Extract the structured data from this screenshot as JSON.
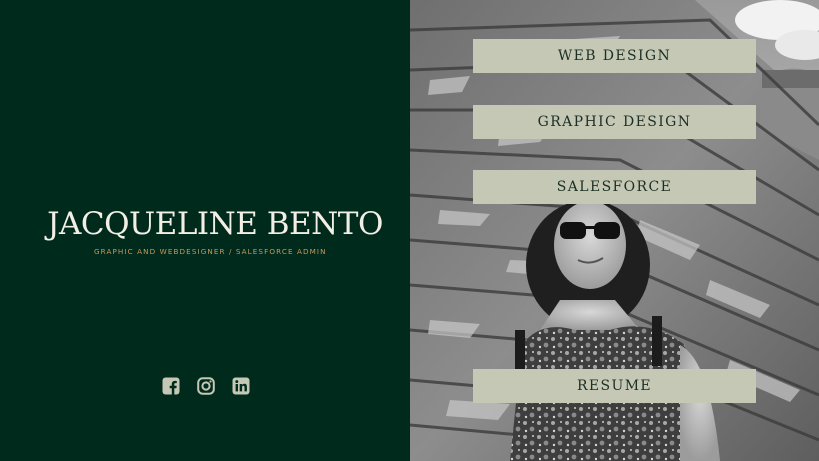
{
  "profile": {
    "name": "JACQUELINE BENTO",
    "tagline": "GRAPHIC AND WEBDESIGNER / SALESFORCE ADMIN"
  },
  "social": [
    {
      "icon": "facebook-icon"
    },
    {
      "icon": "instagram-icon"
    },
    {
      "icon": "linkedin-icon"
    }
  ],
  "nav": {
    "web_design": "WEB DESIGN",
    "graphic_design": "GRAPHIC DESIGN",
    "salesforce": "SALESFORCE",
    "resume": "RESUME"
  },
  "colors": {
    "background": "#002a1c",
    "name": "#f2efe6",
    "tagline": "#c69a5c",
    "button_bg": "#c4c8b4",
    "button_text": "#1d2f25",
    "icons": "#c4c8b4"
  }
}
